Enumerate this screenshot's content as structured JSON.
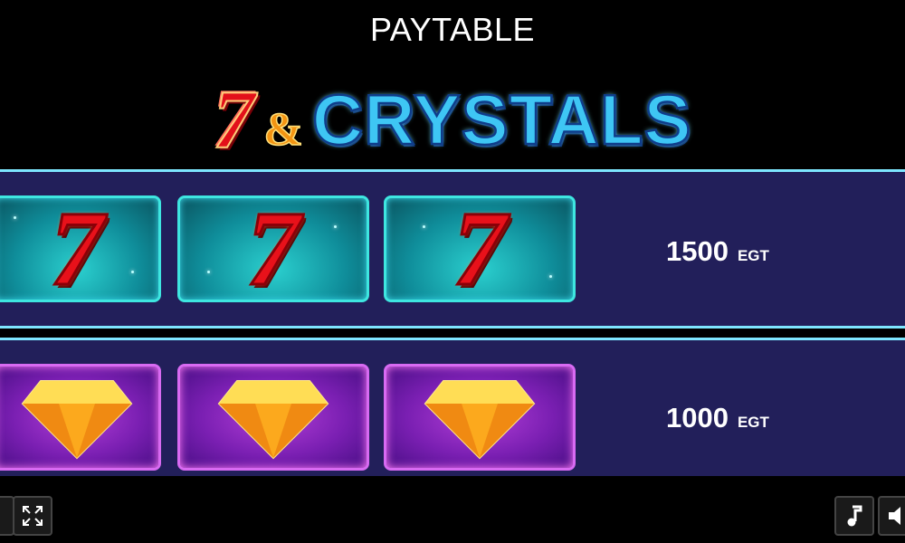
{
  "header": {
    "title": "PAYTABLE"
  },
  "logo": {
    "seven": "7",
    "amp": "&",
    "crystals": "CRYSTALS"
  },
  "paytable": {
    "rows": [
      {
        "symbol": "seven",
        "count": 3,
        "amount": "1500",
        "currency": "EGT"
      },
      {
        "symbol": "diamond",
        "count": 3,
        "amount": "1000",
        "currency": "EGT"
      }
    ]
  },
  "controls": {
    "left": [
      "back-icon",
      "fullscreen-icon"
    ],
    "right": [
      "music-icon",
      "sound-icon"
    ]
  },
  "colors": {
    "background": "#000000",
    "row_bg": "#221f5a",
    "divider": "#7ee6ff",
    "seven_red": "#e8111a",
    "crystals_blue": "#3ec6f4"
  }
}
